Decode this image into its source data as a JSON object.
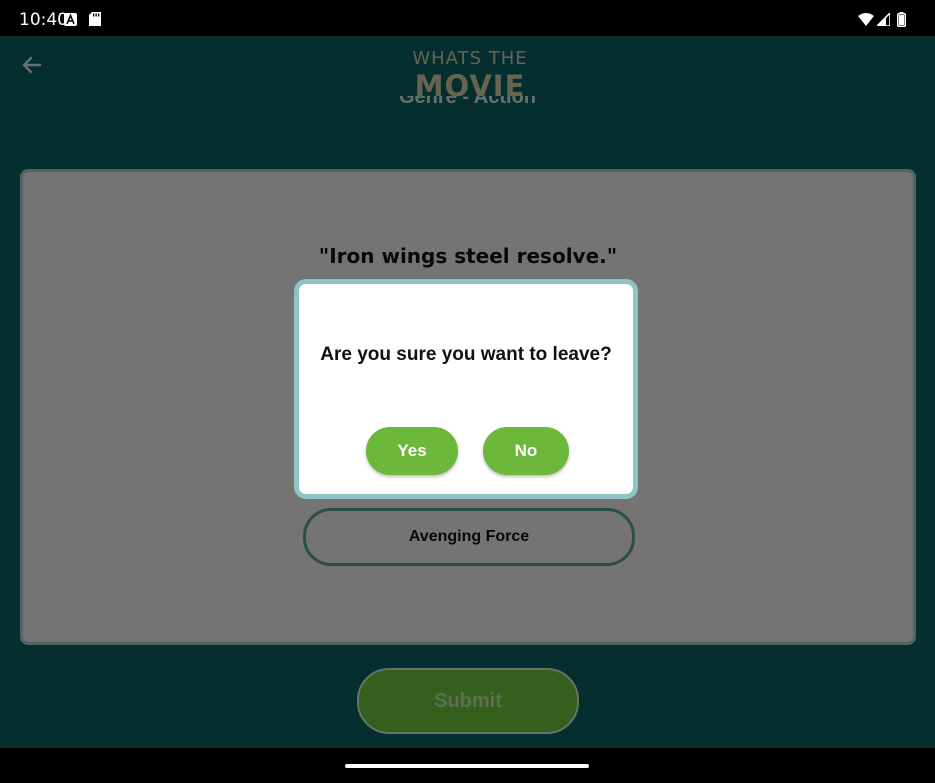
{
  "status_bar": {
    "time": "10:40",
    "icons": [
      "notification-a-icon",
      "sd-card-icon",
      "wifi-icon",
      "signal-icon",
      "battery-icon"
    ]
  },
  "header": {
    "logo_line1": "WHATS THE",
    "logo_line2": "MOVIE",
    "genre_text": "Genre - Action"
  },
  "quiz": {
    "quote": "\"Iron wings steel resolve.\"",
    "option_label": "Avenging Force",
    "submit_label": "Submit"
  },
  "dialog": {
    "message": "Are you sure you want to leave?",
    "yes_label": "Yes",
    "no_label": "No"
  },
  "colors": {
    "app_background": "#0b5f5f",
    "accent_green": "#6bb83a",
    "card_border": "#9fc8c8",
    "logo_gold": "#cfc7a3"
  }
}
